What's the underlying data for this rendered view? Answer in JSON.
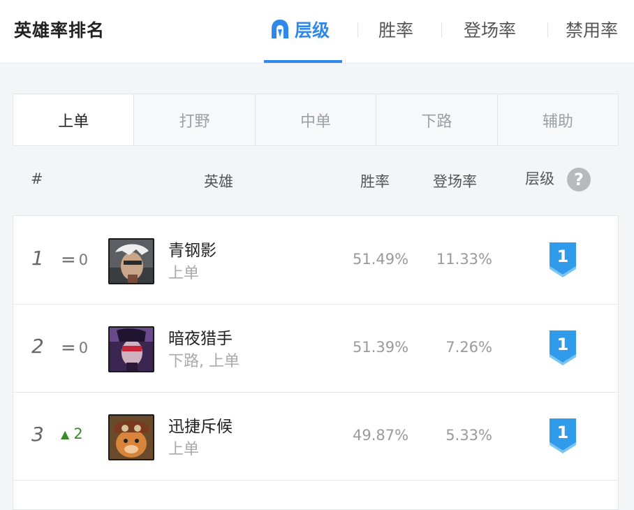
{
  "header": {
    "title": "英雄率排名",
    "tabs": [
      {
        "label": "层级",
        "active": true,
        "icon": "helmet-icon"
      },
      {
        "label": "胜率"
      },
      {
        "label": "登场率"
      },
      {
        "label": "禁用率"
      }
    ]
  },
  "roles": [
    "上单",
    "打野",
    "中单",
    "下路",
    "辅助"
  ],
  "active_role": "上单",
  "table": {
    "columns": {
      "rank": "#",
      "hero": "英雄",
      "winrate": "胜率",
      "pickrate": "登场率",
      "tier": "层级"
    },
    "help": "?",
    "rows": [
      {
        "rank": "1",
        "change_symbol": "=",
        "change": "0",
        "change_dir": "same",
        "name": "青钢影",
        "role": "上单",
        "winrate": "51.49%",
        "pickrate": "11.33%",
        "tier": "1"
      },
      {
        "rank": "2",
        "change_symbol": "=",
        "change": "0",
        "change_dir": "same",
        "name": "暗夜猎手",
        "role": "下路, 上单",
        "winrate": "51.39%",
        "pickrate": "7.26%",
        "tier": "1"
      },
      {
        "rank": "3",
        "change_symbol": "▲",
        "change": "2",
        "change_dir": "up",
        "name": "迅捷斥候",
        "role": "上单",
        "winrate": "49.87%",
        "pickrate": "5.33%",
        "tier": "1"
      }
    ]
  },
  "colors": {
    "accent": "#2f88ea",
    "up": "#3a8a2e",
    "tier_badge": "#2f9bea"
  }
}
